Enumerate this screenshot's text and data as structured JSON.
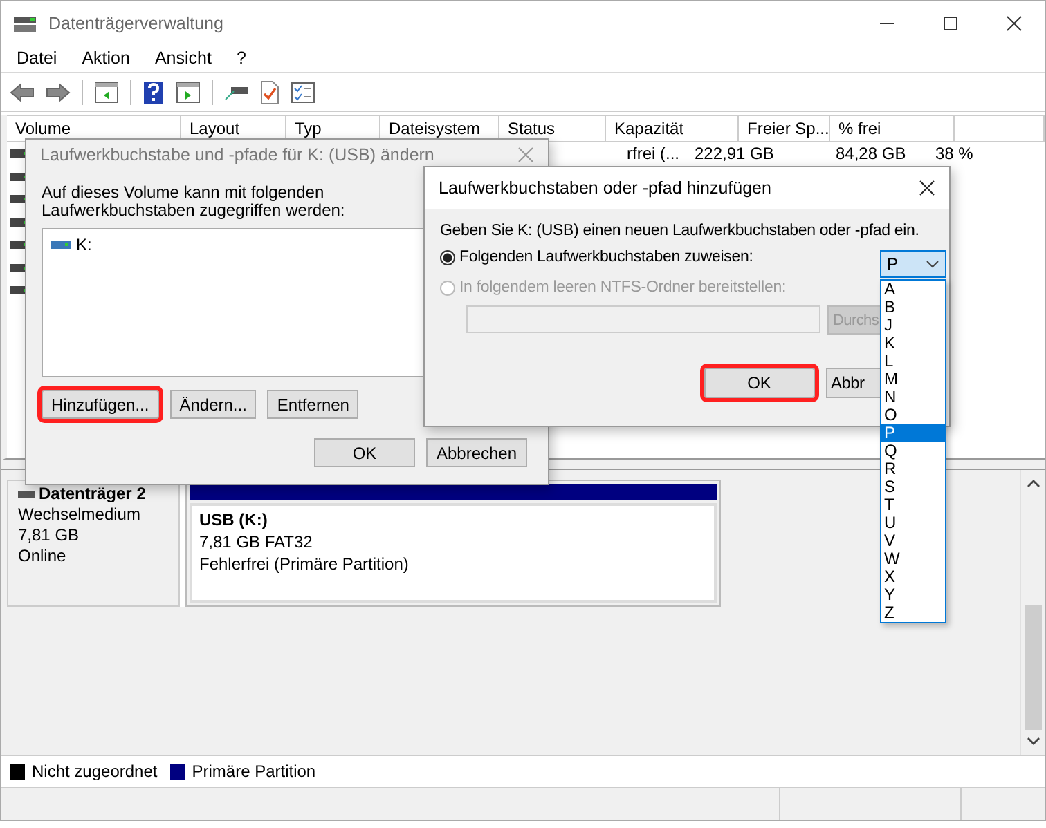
{
  "window": {
    "title": "Datenträgerverwaltung"
  },
  "menu": [
    "Datei",
    "Aktion",
    "Ansicht",
    "?"
  ],
  "table": {
    "columns": [
      "Volume",
      "Layout",
      "Typ",
      "Dateisystem",
      "Status",
      "Kapazität",
      "Freier Sp...",
      "% frei"
    ],
    "rows": [
      {
        "kind": "volume",
        "status": "rfrei (...",
        "capacity": "222,91 GB",
        "free": "84,28 GB",
        "percent": "38 %"
      },
      {
        "kind": "volume"
      },
      {
        "kind": "volume"
      },
      {
        "kind": "volume"
      },
      {
        "kind": "volume"
      },
      {
        "kind": "volume"
      },
      {
        "kind": "volume"
      }
    ]
  },
  "disk": {
    "name": "Datenträger 2",
    "type": "Wechselmedium",
    "size": "7,81 GB",
    "state": "Online",
    "partition": {
      "label": "USB  (K:)",
      "size": "7,81 GB FAT32",
      "status": "Fehlerfrei (Primäre Partition)",
      "color": "#000080"
    }
  },
  "legend": [
    {
      "label": "Nicht zugeordnet",
      "color": "#000000"
    },
    {
      "label": "Primäre Partition",
      "color": "#000080"
    }
  ],
  "dialog_change": {
    "title": "Laufwerkbuchstabe und -pfade für K: (USB) ändern",
    "text": "Auf dieses Volume kann mit folgenden Laufwerkbuchstaben zugegriffen werden:",
    "items": [
      "K:"
    ],
    "buttons": [
      {
        "label": "Hinzufügen...",
        "highlighted": true
      },
      {
        "label": "Ändern...",
        "highlighted": false
      },
      {
        "label": "Entfernen",
        "highlighted": false
      }
    ],
    "footer_buttons": [
      {
        "label": "OK",
        "highlighted": false
      },
      {
        "label": "Abbrechen",
        "highlighted": false
      }
    ]
  },
  "dialog_add": {
    "title": "Laufwerkbuchstaben oder -pfad hinzufügen",
    "text": "Geben Sie K: (USB) einen neuen Laufwerkbuchstaben oder -pfad ein.",
    "options": [
      {
        "label": "Folgenden Laufwerkbuchstaben zuweisen:",
        "selected": true,
        "disabled": false
      },
      {
        "label": "In folgendem leeren NTFS-Ordner bereitstellen:",
        "selected": false,
        "disabled": true
      }
    ],
    "dropdown": {
      "value": "P",
      "open": true,
      "items": [
        {
          "label": "A",
          "selected": false
        },
        {
          "label": "B",
          "selected": false
        },
        {
          "label": "J",
          "selected": false
        },
        {
          "label": "K",
          "selected": false
        },
        {
          "label": "L",
          "selected": false
        },
        {
          "label": "M",
          "selected": false
        },
        {
          "label": "N",
          "selected": false
        },
        {
          "label": "O",
          "selected": false
        },
        {
          "label": "P",
          "selected": true
        },
        {
          "label": "Q",
          "selected": false
        },
        {
          "label": "R",
          "selected": false
        },
        {
          "label": "S",
          "selected": false
        },
        {
          "label": "T",
          "selected": false
        },
        {
          "label": "U",
          "selected": false
        },
        {
          "label": "V",
          "selected": false
        },
        {
          "label": "W",
          "selected": false
        },
        {
          "label": "X",
          "selected": false
        },
        {
          "label": "Y",
          "selected": false
        },
        {
          "label": "Z",
          "selected": false
        }
      ]
    },
    "browse_button": {
      "label": "Durchs",
      "disabled": true
    },
    "buttons": [
      {
        "label": "OK",
        "highlighted": true
      },
      {
        "label": "Abbr",
        "highlighted": false
      }
    ]
  }
}
